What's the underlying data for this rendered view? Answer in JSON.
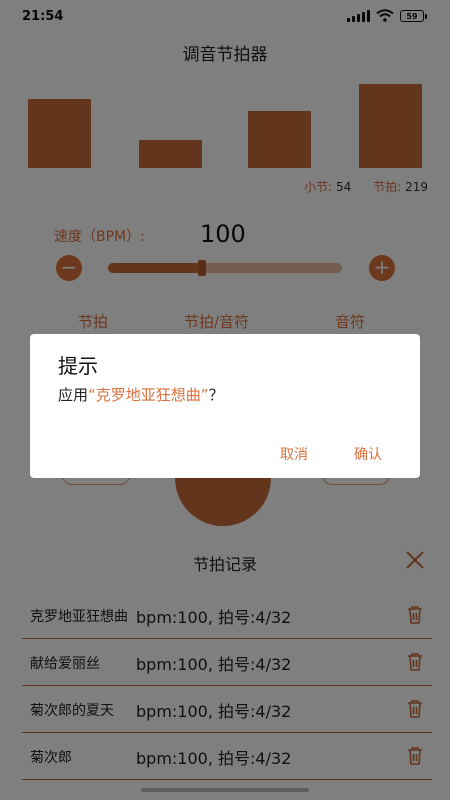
{
  "status_bar": {
    "time": "21:54",
    "battery": "59",
    "icons": [
      "signal-icon",
      "wifi-icon",
      "battery-icon"
    ]
  },
  "header": {
    "title": "调音节拍器"
  },
  "beat_meter": {
    "bar_levels": [
      0.82,
      0.33,
      0.68,
      1.0
    ],
    "measure_label": "小节:",
    "measure_value": "54",
    "beat_label": "节拍:",
    "beat_value": "219"
  },
  "tempo": {
    "label": "速度（BPM）:",
    "value": "100",
    "minus_symbol": "−",
    "plus_symbol": "+",
    "slider_fraction": 0.4
  },
  "tabs": [
    "节拍",
    "节拍/音符",
    "音符"
  ],
  "history": {
    "title": "节拍记录",
    "records": [
      {
        "name": "克罗地亚狂想曲",
        "info": "bpm:100, 拍号:4/32"
      },
      {
        "name": "献给爱丽丝",
        "info": "bpm:100, 拍号:4/32"
      },
      {
        "name": "菊次郎的夏天",
        "info": "bpm:100, 拍号:4/32"
      },
      {
        "name": "菊次郎",
        "info": "bpm:100, 拍号:4/32"
      }
    ]
  },
  "dialog": {
    "title": "提示",
    "message_prefix": "应用",
    "message_highlight": "“克罗地亚狂想曲”",
    "message_suffix": "？",
    "cancel_label": "取消",
    "confirm_label": "确认"
  },
  "colors": {
    "accent": "#d9703d",
    "bar": "#c86a3a",
    "scrim": "rgba(0,0,0,0.5)"
  }
}
